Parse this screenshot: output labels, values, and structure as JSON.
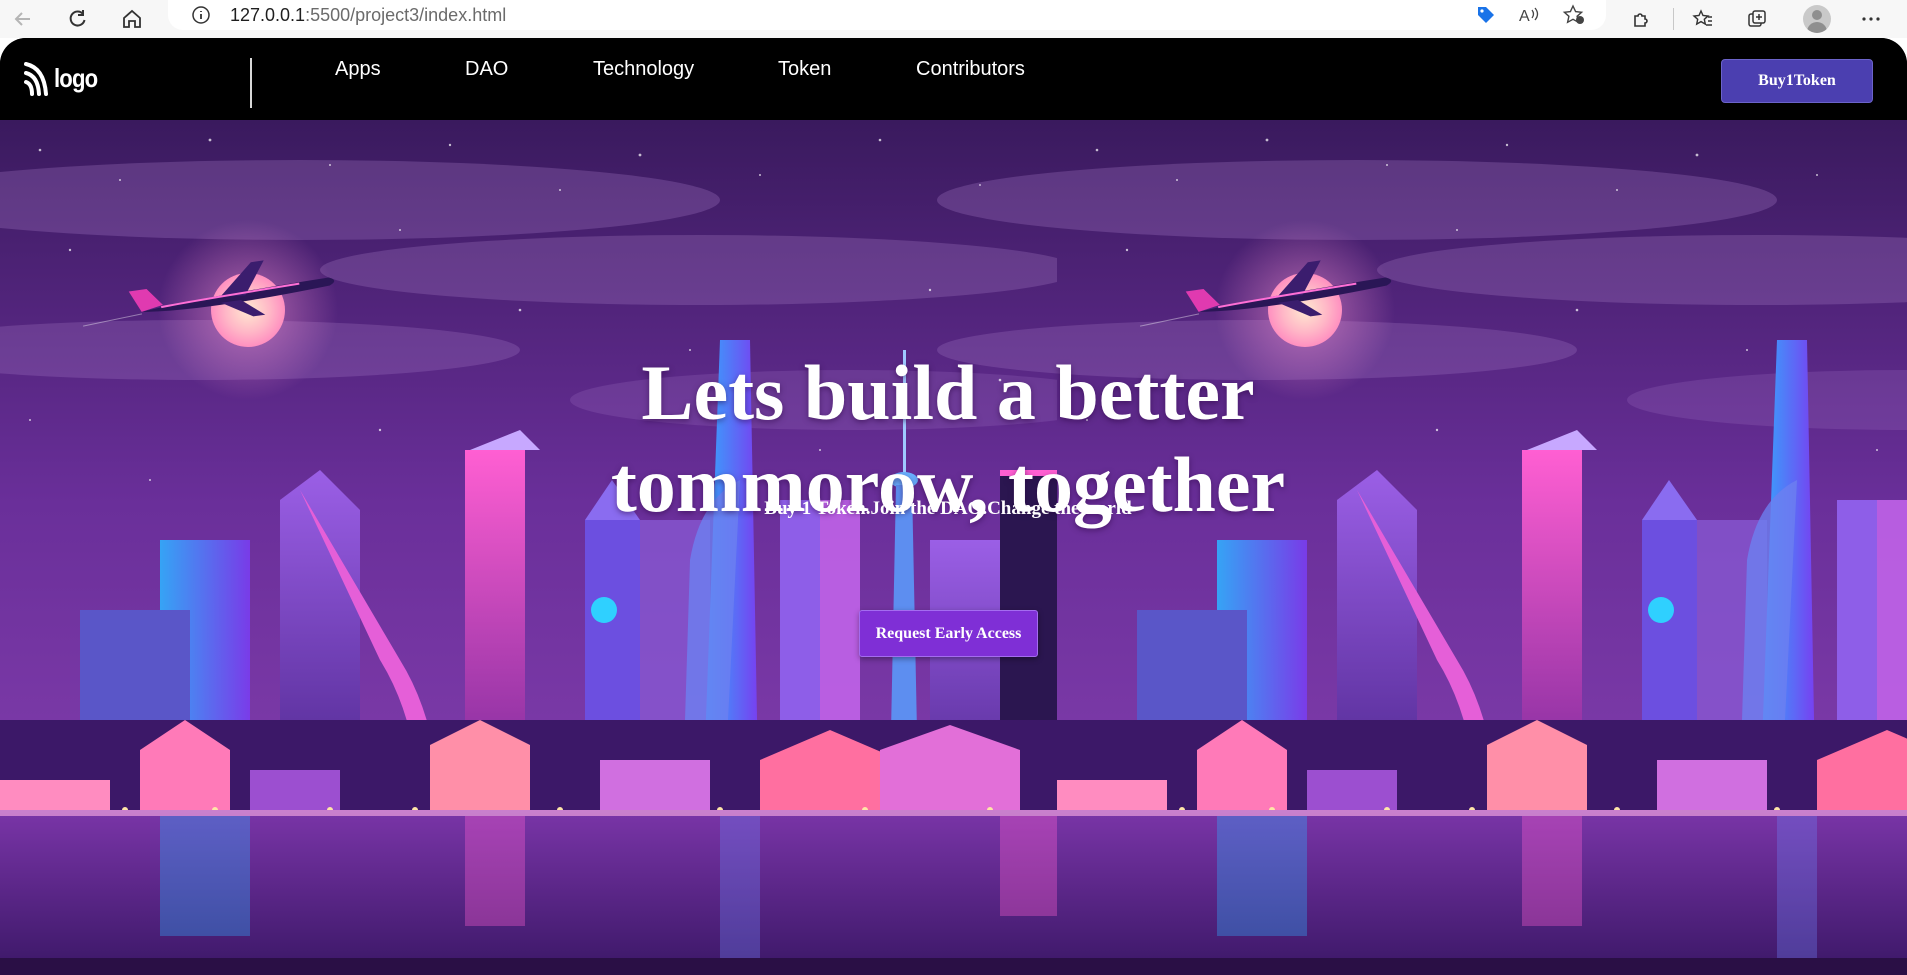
{
  "browser": {
    "url_main": "127.0.0.1",
    "url_rest": ":5500/project3/index.html",
    "icons": [
      "back-arrow-icon",
      "reload-icon",
      "home-icon",
      "info-icon",
      "tag-icon",
      "read-aloud-icon",
      "favorite-add-icon",
      "extensions-icon",
      "favorites-icon",
      "collections-icon",
      "profile-avatar-icon",
      "more-icon"
    ]
  },
  "navbar": {
    "logo_text": "logo",
    "links": [
      "Apps",
      "DAO",
      "Technology",
      "Token",
      "Contributors"
    ],
    "cta_label": "Buy1Token"
  },
  "hero": {
    "headline_line1": "Lets build a better",
    "headline_line2": "tommorow, together",
    "subheadline": "Buy 1 Token.Join the DAO.Change the world",
    "button_label": "Request Early Access"
  },
  "colors": {
    "navbar_bg": "#000000",
    "cta_bg": "#4b3fb0",
    "access_bg": "#7f2fd6",
    "sky_top": "#3a1a5e",
    "sky_mid": "#6a2f9a",
    "water": "#4a1f78"
  }
}
